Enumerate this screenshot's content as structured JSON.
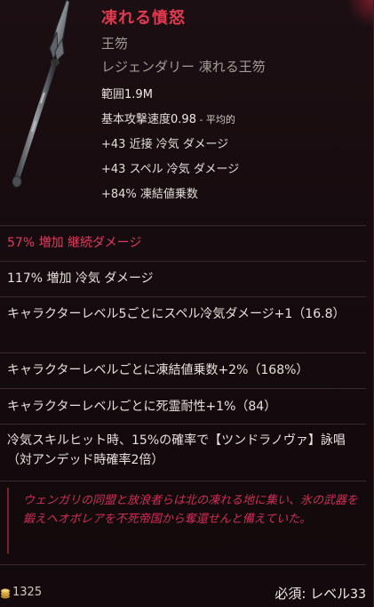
{
  "item": {
    "name": "凍れる憤怒",
    "type": "王笏",
    "rarity_line": "レジェンダリー 凍れる王笏"
  },
  "stats": {
    "range_label": "範囲",
    "range_value": "1.9M",
    "attack_speed_label": "基本攻撃速度",
    "attack_speed_value": "0.98",
    "attack_speed_tag": " - 平均的",
    "line1": "+43 近接 冷気 ダメージ",
    "line2": "+43 スペル 冷気 ダメージ",
    "line3": "+84% 凍結値乗数"
  },
  "affixes": [
    {
      "text": "57% 増加 継続ダメージ"
    },
    {
      "text": "117% 増加 冷気 ダメージ"
    },
    {
      "text": "キャラクターレベル5ごとにスペル冷気ダメージ+1（16.8）"
    },
    {
      "text": "キャラクターレベルごとに凍結値乗数+2%（168%）"
    },
    {
      "text": "キャラクターレベルごとに死霊耐性+1%（84）"
    },
    {
      "text": "冷気スキルヒット時、15%の確率で【ツンドラノヴァ】詠唱（対アンデッド時確率2倍）"
    }
  ],
  "flavor": "ウェンガリの同盟と放浪者らは北の凍れる地に集い、氷の武器を鍛えヘオボレアを不死帝国から奪還せんと備えていた。",
  "footer": {
    "gold": "1325",
    "requirement_label": "必須: レベル",
    "requirement_level": "33"
  },
  "colors": {
    "title": "#e03a50",
    "affix_highlight": "#e03a63",
    "flavor": "#d22c58"
  },
  "icons": [
    "scepter-icon",
    "gold-coins-icon"
  ]
}
